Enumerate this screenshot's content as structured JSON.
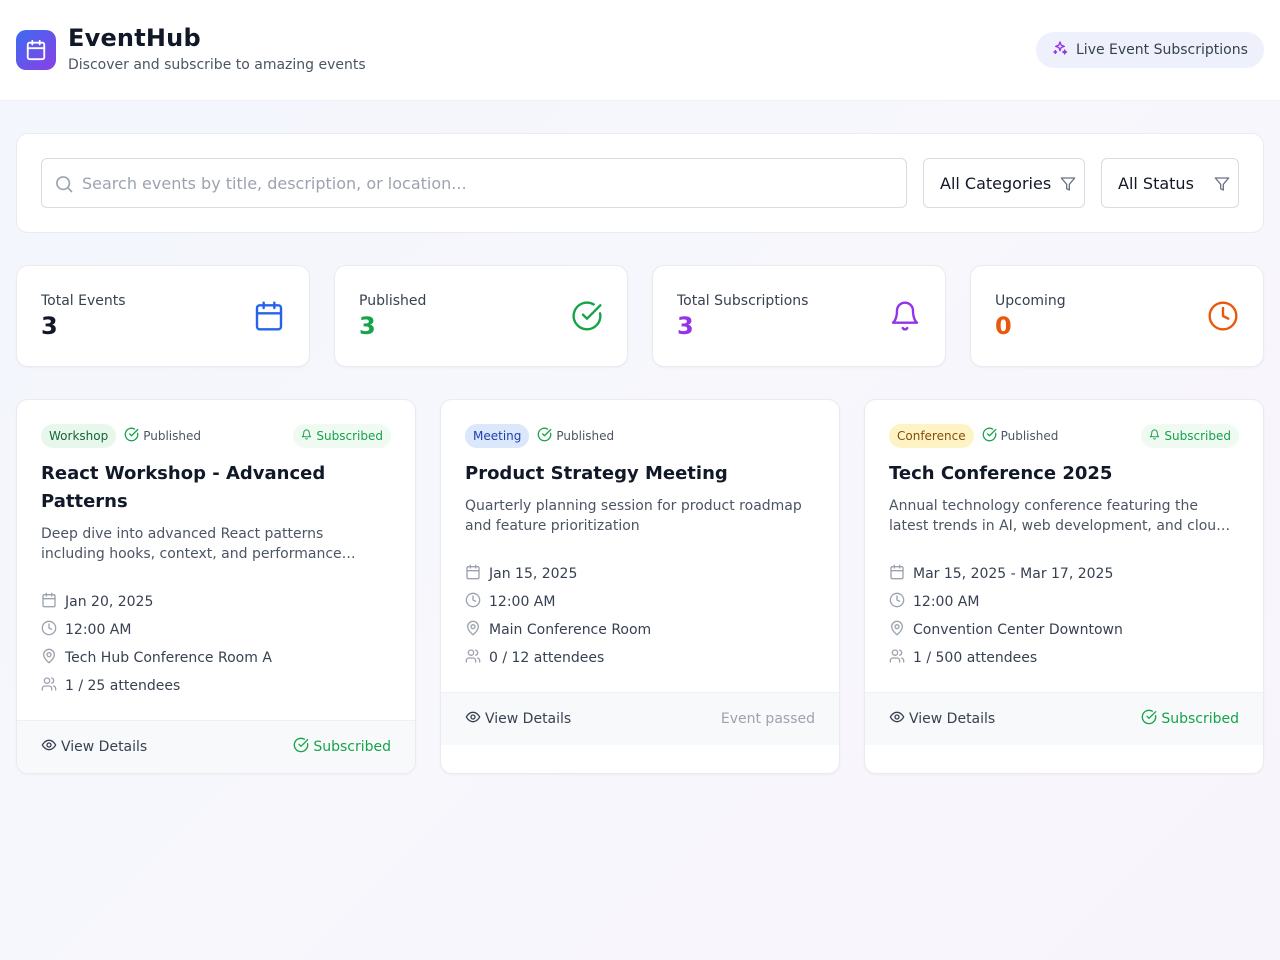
{
  "header": {
    "title": "EventHub",
    "subtitle": "Discover and subscribe to amazing events",
    "live_label": "Live Event Subscriptions",
    "logo_icon": "calendar-icon",
    "live_icon": "sparkles-icon"
  },
  "filters": {
    "search_placeholder": "Search events by title, description, or location...",
    "search_value": "",
    "category_selected": "All Categories",
    "status_selected": "All Status"
  },
  "stats": [
    {
      "label": "Total Events",
      "value": "3",
      "color": "#111827",
      "icon": "calendar-icon",
      "icon_color": "#2563eb"
    },
    {
      "label": "Published",
      "value": "3",
      "color": "#16a34a",
      "icon": "check-circle-icon",
      "icon_color": "#16a34a"
    },
    {
      "label": "Total Subscriptions",
      "value": "3",
      "color": "#9333ea",
      "icon": "bell-icon",
      "icon_color": "#9333ea"
    },
    {
      "label": "Upcoming",
      "value": "0",
      "color": "#ea580c",
      "icon": "clock-icon",
      "icon_color": "#ea580c"
    }
  ],
  "events": [
    {
      "category": "Workshop",
      "category_bg": "#e8f7ec",
      "category_color": "#166534",
      "status": "Published",
      "subscribed_badge": "Subscribed",
      "title": "React Workshop - Advanced Patterns",
      "description": "Deep dive into advanced React patterns including hooks, context, and performance optimization",
      "date": "Jan 20, 2025",
      "time": "12:00 AM",
      "location": "Tech Hub Conference Room A",
      "attendees": "1 / 25 attendees",
      "view_label": "View Details",
      "footer_state": "Subscribed"
    },
    {
      "category": "Meeting",
      "category_bg": "#dbe7fb",
      "category_color": "#1e40af",
      "status": "Published",
      "subscribed_badge": "",
      "title": "Product Strategy Meeting",
      "description": "Quarterly planning session for product roadmap and feature prioritization",
      "date": "Jan 15, 2025",
      "time": "12:00 AM",
      "location": "Main Conference Room",
      "attendees": "0 / 12 attendees",
      "view_label": "View Details",
      "footer_state": "Event passed"
    },
    {
      "category": "Conference",
      "category_bg": "#fdf3c4",
      "category_color": "#854d0e",
      "status": "Published",
      "subscribed_badge": "Subscribed",
      "title": "Tech Conference 2025",
      "description": "Annual technology conference featuring the latest trends in AI, web development, and cloud computing",
      "date": "Mar 15, 2025 - Mar 17, 2025",
      "time": "12:00 AM",
      "location": "Convention Center Downtown",
      "attendees": "1 / 500 attendees",
      "view_label": "View Details",
      "footer_state": "Subscribed"
    }
  ]
}
